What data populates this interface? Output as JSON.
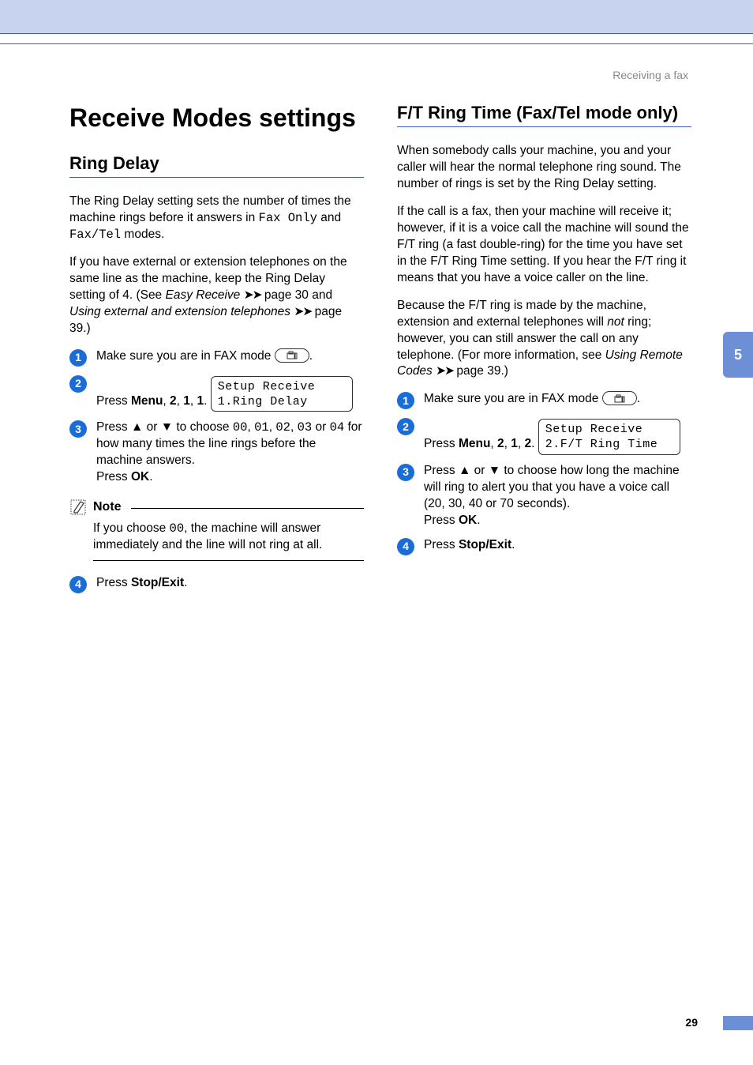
{
  "header": {
    "breadcrumb": "Receiving a fax"
  },
  "chapter_tab": "5",
  "left": {
    "h1": "Receive Modes settings",
    "h2": "Ring Delay",
    "p1_a": "The Ring Delay setting sets the number of times the machine rings before it answers in ",
    "p1_mono1": "Fax Only",
    "p1_b": " and ",
    "p1_mono2": "Fax/Tel",
    "p1_c": " modes.",
    "p2_a": "If you have external or extension telephones on the same line as the machine, keep the Ring Delay setting of 4. (See ",
    "p2_i1": "Easy Receive",
    "p2_b": " page 30 and ",
    "p2_i2": "Using external and extension telephones",
    "p2_c": " page 39.)",
    "step1_a": "Make sure you are in FAX mode ",
    "step1_b": ".",
    "step2_a": "Press ",
    "step2_menu": "Menu",
    "step2_b": ", ",
    "step2_n1": "2",
    "step2_n2": "1",
    "step2_n3": "1",
    "step2_dot": ".",
    "lcd1_l1": "Setup Receive",
    "lcd1_l2": "1.Ring Delay",
    "step3_a": "Press ",
    "step3_tri_up": "a",
    "step3_mid": " or ",
    "step3_tri_dn": "b",
    "step3_b": " to choose ",
    "step3_v0": "00",
    "step3_v1": "01",
    "step3_v2": "02",
    "step3_v3": "03",
    "step3_v4": "04",
    "step3_c": " for how many times the line rings before the machine answers.",
    "step3_d": "Press ",
    "step3_ok": "OK",
    "step3_dot": ".",
    "note_label": "Note",
    "note_a": "If you choose ",
    "note_mono": "00",
    "note_b": ", the machine will answer immediately and the line will not ring at all.",
    "step4_a": "Press ",
    "step4_btn": "Stop/Exit",
    "step4_dot": "."
  },
  "right": {
    "h2": "F/T Ring Time (Fax/Tel mode only)",
    "p1": "When somebody calls your machine, you and your caller will hear the normal telephone ring sound. The number of rings is set by the Ring Delay setting.",
    "p2": "If the call is a fax, then your machine will receive it; however, if it is a voice call the machine will sound the F/T ring (a fast double-ring) for the time you have set in the F/T Ring Time setting. If you hear the F/T ring it means that you have a voice caller on the line.",
    "p3_a": "Because the F/T ring is made by the machine, extension and external telephones will ",
    "p3_i1": "not",
    "p3_b": " ring; however, you can still answer the call on any telephone. (For more information, see ",
    "p3_i2": "Using Remote Codes",
    "p3_c": " page 39.)",
    "step1_a": "Make sure you are in FAX mode ",
    "step1_b": ".",
    "step2_a": "Press ",
    "step2_menu": "Menu",
    "step2_b": ", ",
    "step2_n1": "2",
    "step2_n2": "1",
    "step2_n3": "2",
    "step2_dot": ".",
    "lcd1_l1": "Setup Receive",
    "lcd1_l2": "2.F/T Ring Time",
    "step3_a": "Press ",
    "step3_mid": " or ",
    "step3_b": " to choose how long the machine will ring to alert you that you have a voice call (20, 30, 40 or 70 seconds).",
    "step3_c": "Press ",
    "step3_ok": "OK",
    "step3_dot": ".",
    "step4_a": "Press ",
    "step4_btn": "Stop/Exit",
    "step4_dot": "."
  },
  "page_number": "29"
}
